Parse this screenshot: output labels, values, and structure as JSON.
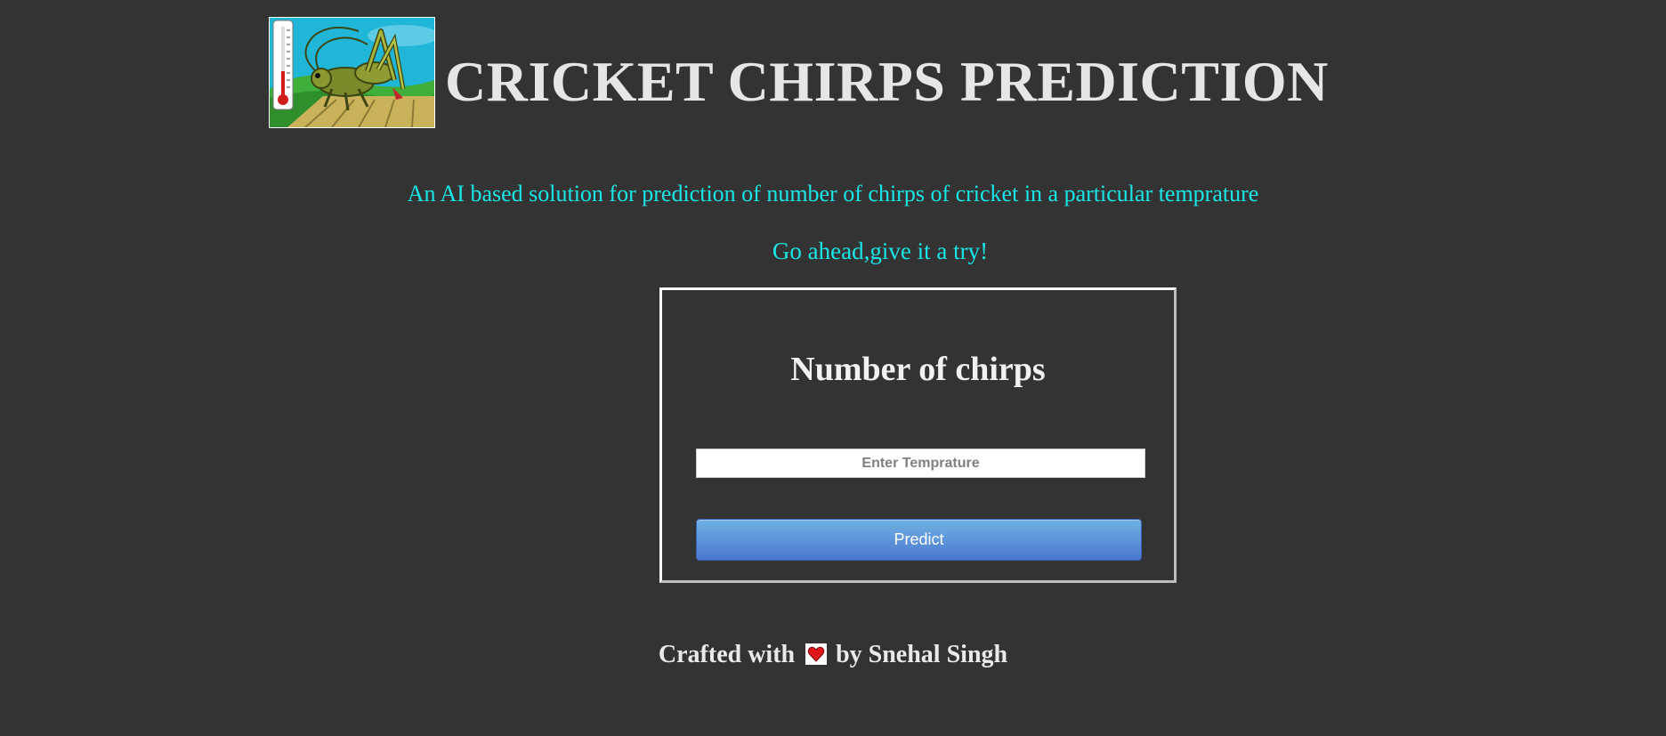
{
  "header": {
    "logo_icon": "cricket-thermometer-logo",
    "title": "CRICKET CHIRPS PREDICTION"
  },
  "intro": {
    "tagline": "An AI based solution for prediction of number of chirps of cricket in a particular temprature",
    "cta": "Go ahead,give it a try!"
  },
  "form": {
    "title": "Number of chirps",
    "input_placeholder": "Enter Temprature",
    "input_value": "",
    "button_label": "Predict"
  },
  "footer": {
    "prefix": "Crafted with",
    "heart_icon": "heart-icon",
    "suffix": "by Snehal Singh"
  },
  "colors": {
    "background": "#333333",
    "accent_text": "#19e6e6",
    "title_text": "#e6e6e6",
    "button": "#5f95da"
  }
}
